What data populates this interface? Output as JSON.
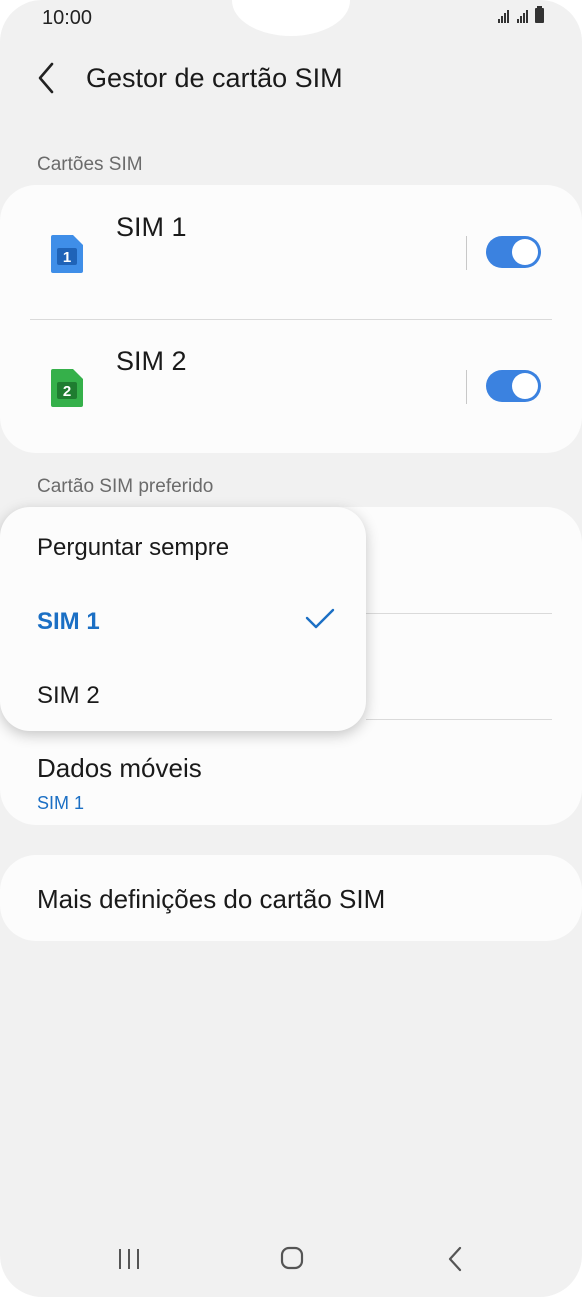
{
  "status_bar": {
    "time": "10:00"
  },
  "header": {
    "title": "Gestor de cartão SIM",
    "back_icon": "chevron-left-icon"
  },
  "sections": {
    "sim_cards_label": "Cartões SIM",
    "preferred_label": "Cartão SIM preferido"
  },
  "sim_cards": [
    {
      "name": "SIM 1",
      "number": "1",
      "color": "#3f8ee8",
      "enabled": true
    },
    {
      "name": "SIM 2",
      "number": "2",
      "color": "#35b04a",
      "enabled": true
    }
  ],
  "preferred": {
    "mobile_data_title": "Dados móveis",
    "mobile_data_value": "SIM 1"
  },
  "popup": {
    "options": [
      "Perguntar sempre",
      "SIM 1",
      "SIM 2"
    ],
    "selected": "SIM 1"
  },
  "more_settings": {
    "label": "Mais definições do cartão SIM"
  },
  "colors": {
    "accent": "#1b6fc4",
    "toggle_on": "#3b82e0",
    "background": "#f1f1f1",
    "card": "#fcfcfc"
  },
  "navbar": {
    "icons": [
      "recent-apps-icon",
      "home-icon",
      "back-icon"
    ]
  }
}
